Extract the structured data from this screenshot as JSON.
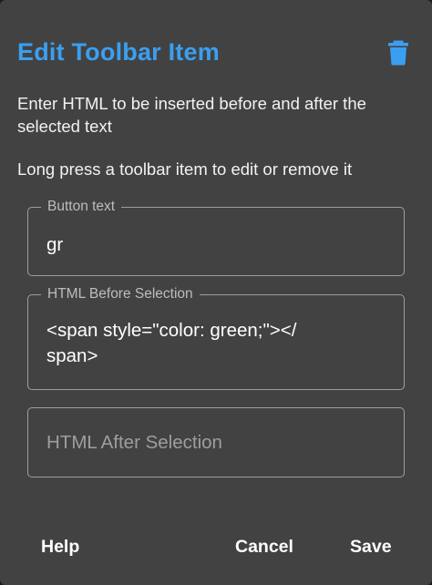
{
  "dialog": {
    "title": "Edit Toolbar Item",
    "delete_icon": "trash-icon",
    "description_1": "Enter HTML to be inserted before and after the selected text",
    "description_2": "Long press a toolbar item to edit or remove it",
    "accent_color": "#3b9ff0",
    "background_color": "#424242"
  },
  "fields": {
    "button_text": {
      "label": "Button text",
      "value": "gr"
    },
    "html_before": {
      "label": "HTML Before Selection",
      "value": "<span style=\"color: green;\"></\nspan>"
    },
    "html_after": {
      "placeholder": "HTML After Selection",
      "value": ""
    }
  },
  "actions": {
    "help": "Help",
    "cancel": "Cancel",
    "save": "Save"
  }
}
